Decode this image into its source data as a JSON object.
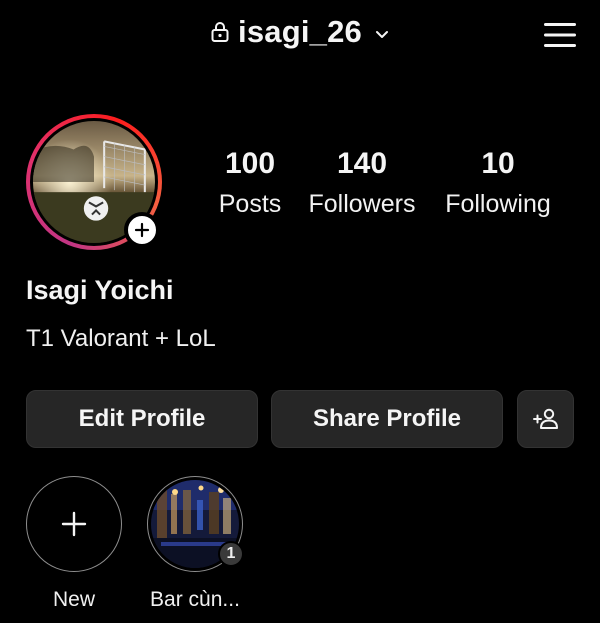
{
  "header": {
    "username": "isagi_26",
    "lock_icon": "lock-icon",
    "dropdown_icon": "chevron-down-icon",
    "menu_icon": "hamburger-menu-icon"
  },
  "profile": {
    "stats": [
      {
        "value": "100",
        "label": "Posts"
      },
      {
        "value": "140",
        "label": "Followers"
      },
      {
        "value": "10",
        "label": "Following"
      }
    ],
    "display_name": "Isagi Yoichi",
    "bio": "T1 Valorant + LoL"
  },
  "actions": {
    "edit_profile": "Edit Profile",
    "share_profile": "Share Profile",
    "add_user_icon": "add-person-icon"
  },
  "highlights": [
    {
      "label": "New",
      "icon": "plus-icon"
    },
    {
      "label": "Bar cùn...",
      "count": "1"
    }
  ],
  "colors": {
    "background": "#000000",
    "button_bg": "#262626",
    "ring_gradient": [
      "#c13584",
      "#e1306c",
      "#fd1d1d",
      "#f56040"
    ]
  }
}
